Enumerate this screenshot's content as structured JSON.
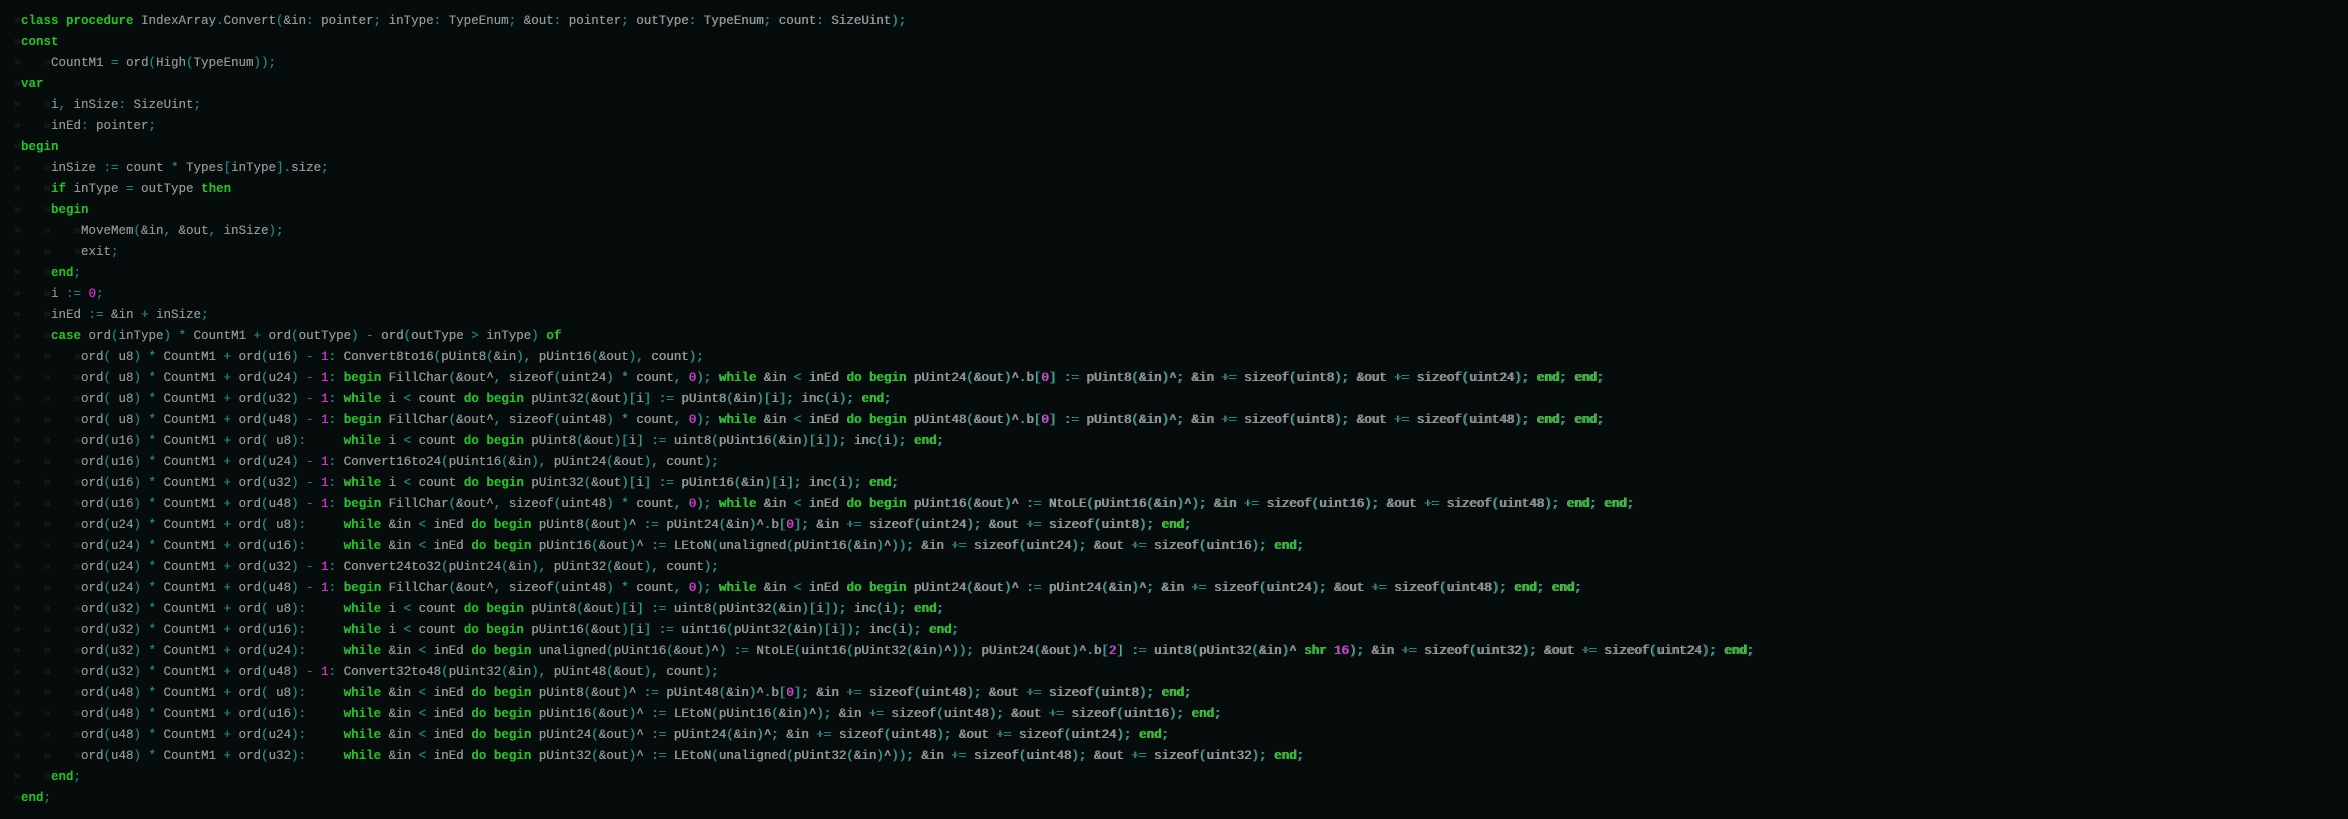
{
  "editor": {
    "tab_marker": "»",
    "colors": {
      "background": "#060c0c",
      "text": "#8f9898",
      "keyword": "#1fc41f",
      "punctuation": "#108585",
      "number": "#e21ee2"
    },
    "lines": [
      {
        "indent": 0,
        "text": "class procedure IndexArray.Convert(&in: pointer; inType: TypeEnum; &out: pointer; outType: TypeEnum; count: SizeUint);"
      },
      {
        "indent": 0,
        "text": "const"
      },
      {
        "indent": 1,
        "text": "CountM1 = ord(High(TypeEnum));"
      },
      {
        "indent": 0,
        "text": "var"
      },
      {
        "indent": 1,
        "text": "i, inSize: SizeUint;"
      },
      {
        "indent": 1,
        "text": "inEd: pointer;"
      },
      {
        "indent": 0,
        "text": "begin"
      },
      {
        "indent": 1,
        "text": "inSize := count * Types[inType].size;"
      },
      {
        "indent": 1,
        "text": "if inType = outType then"
      },
      {
        "indent": 1,
        "text": "begin"
      },
      {
        "indent": 2,
        "text": "MoveMem(&in, &out, inSize);"
      },
      {
        "indent": 2,
        "text": "exit;"
      },
      {
        "indent": 1,
        "text": "end;"
      },
      {
        "indent": 1,
        "text": "i := 0;"
      },
      {
        "indent": 1,
        "text": "inEd := &in + inSize;"
      },
      {
        "indent": 1,
        "text": "case ord(inType) * CountM1 + ord(outType) - ord(outType > inType) of"
      },
      {
        "indent": 2,
        "text": "ord( u8) * CountM1 + ord(u16) - 1: Convert8to16(pUint8(&in), pUint16(&out), count);"
      },
      {
        "indent": 2,
        "text": "ord( u8) * CountM1 + ord(u24) - 1: begin FillChar(&out^, sizeof(uint24) * count, 0); while &in < inEd do begin pUint24(&out)^.b[0] := pUint8(&in)^; &in += sizeof(uint8); &out += sizeof(uint24); end; end;"
      },
      {
        "indent": 2,
        "text": "ord( u8) * CountM1 + ord(u32) - 1: while i < count do begin pUint32(&out)[i] := pUint8(&in)[i]; inc(i); end;"
      },
      {
        "indent": 2,
        "text": "ord( u8) * CountM1 + ord(u48) - 1: begin FillChar(&out^, sizeof(uint48) * count, 0); while &in < inEd do begin pUint48(&out)^.b[0] := pUint8(&in)^; &in += sizeof(uint8); &out += sizeof(uint48); end; end;"
      },
      {
        "indent": 2,
        "text": "ord(u16) * CountM1 + ord( u8):     while i < count do begin pUint8(&out)[i] := uint8(pUint16(&in)[i]); inc(i); end;"
      },
      {
        "indent": 2,
        "text": "ord(u16) * CountM1 + ord(u24) - 1: Convert16to24(pUint16(&in), pUint24(&out), count);"
      },
      {
        "indent": 2,
        "text": "ord(u16) * CountM1 + ord(u32) - 1: while i < count do begin pUint32(&out)[i] := pUint16(&in)[i]; inc(i); end;"
      },
      {
        "indent": 2,
        "text": "ord(u16) * CountM1 + ord(u48) - 1: begin FillChar(&out^, sizeof(uint48) * count, 0); while &in < inEd do begin pUint16(&out)^ := NtoLE(pUint16(&in)^); &in += sizeof(uint16); &out += sizeof(uint48); end; end;"
      },
      {
        "indent": 2,
        "text": "ord(u24) * CountM1 + ord( u8):     while &in < inEd do begin pUint8(&out)^ := pUint24(&in)^.b[0]; &in += sizeof(uint24); &out += sizeof(uint8); end;"
      },
      {
        "indent": 2,
        "text": "ord(u24) * CountM1 + ord(u16):     while &in < inEd do begin pUint16(&out)^ := LEtoN(unaligned(pUint16(&in)^)); &in += sizeof(uint24); &out += sizeof(uint16); end;"
      },
      {
        "indent": 2,
        "text": "ord(u24) * CountM1 + ord(u32) - 1: Convert24to32(pUint24(&in), pUint32(&out), count);"
      },
      {
        "indent": 2,
        "text": "ord(u24) * CountM1 + ord(u48) - 1: begin FillChar(&out^, sizeof(uint48) * count, 0); while &in < inEd do begin pUint24(&out)^ := pUint24(&in)^; &in += sizeof(uint24); &out += sizeof(uint48); end; end;"
      },
      {
        "indent": 2,
        "text": "ord(u32) * CountM1 + ord( u8):     while i < count do begin pUint8(&out)[i] := uint8(pUint32(&in)[i]); inc(i); end;"
      },
      {
        "indent": 2,
        "text": "ord(u32) * CountM1 + ord(u16):     while i < count do begin pUint16(&out)[i] := uint16(pUint32(&in)[i]); inc(i); end;"
      },
      {
        "indent": 2,
        "text": "ord(u32) * CountM1 + ord(u24):     while &in < inEd do begin unaligned(pUint16(&out)^) := NtoLE(uint16(pUint32(&in)^)); pUint24(&out)^.b[2] := uint8(pUint32(&in)^ shr 16); &in += sizeof(uint32); &out += sizeof(uint24); end;"
      },
      {
        "indent": 2,
        "text": "ord(u32) * CountM1 + ord(u48) - 1: Convert32to48(pUint32(&in), pUint48(&out), count);"
      },
      {
        "indent": 2,
        "text": "ord(u48) * CountM1 + ord( u8):     while &in < inEd do begin pUint8(&out)^ := pUint48(&in)^.b[0]; &in += sizeof(uint48); &out += sizeof(uint8); end;"
      },
      {
        "indent": 2,
        "text": "ord(u48) * CountM1 + ord(u16):     while &in < inEd do begin pUint16(&out)^ := LEtoN(pUint16(&in)^); &in += sizeof(uint48); &out += sizeof(uint16); end;"
      },
      {
        "indent": 2,
        "text": "ord(u48) * CountM1 + ord(u24):     while &in < inEd do begin pUint24(&out)^ := pUint24(&in)^; &in += sizeof(uint48); &out += sizeof(uint24); end;"
      },
      {
        "indent": 2,
        "text": "ord(u48) * CountM1 + ord(u32):     while &in < inEd do begin pUint32(&out)^ := LEtoN(unaligned(pUint32(&in)^)); &in += sizeof(uint48); &out += sizeof(uint32); end;"
      },
      {
        "indent": 1,
        "text": "end;"
      },
      {
        "indent": 0,
        "text": "end;"
      }
    ]
  }
}
